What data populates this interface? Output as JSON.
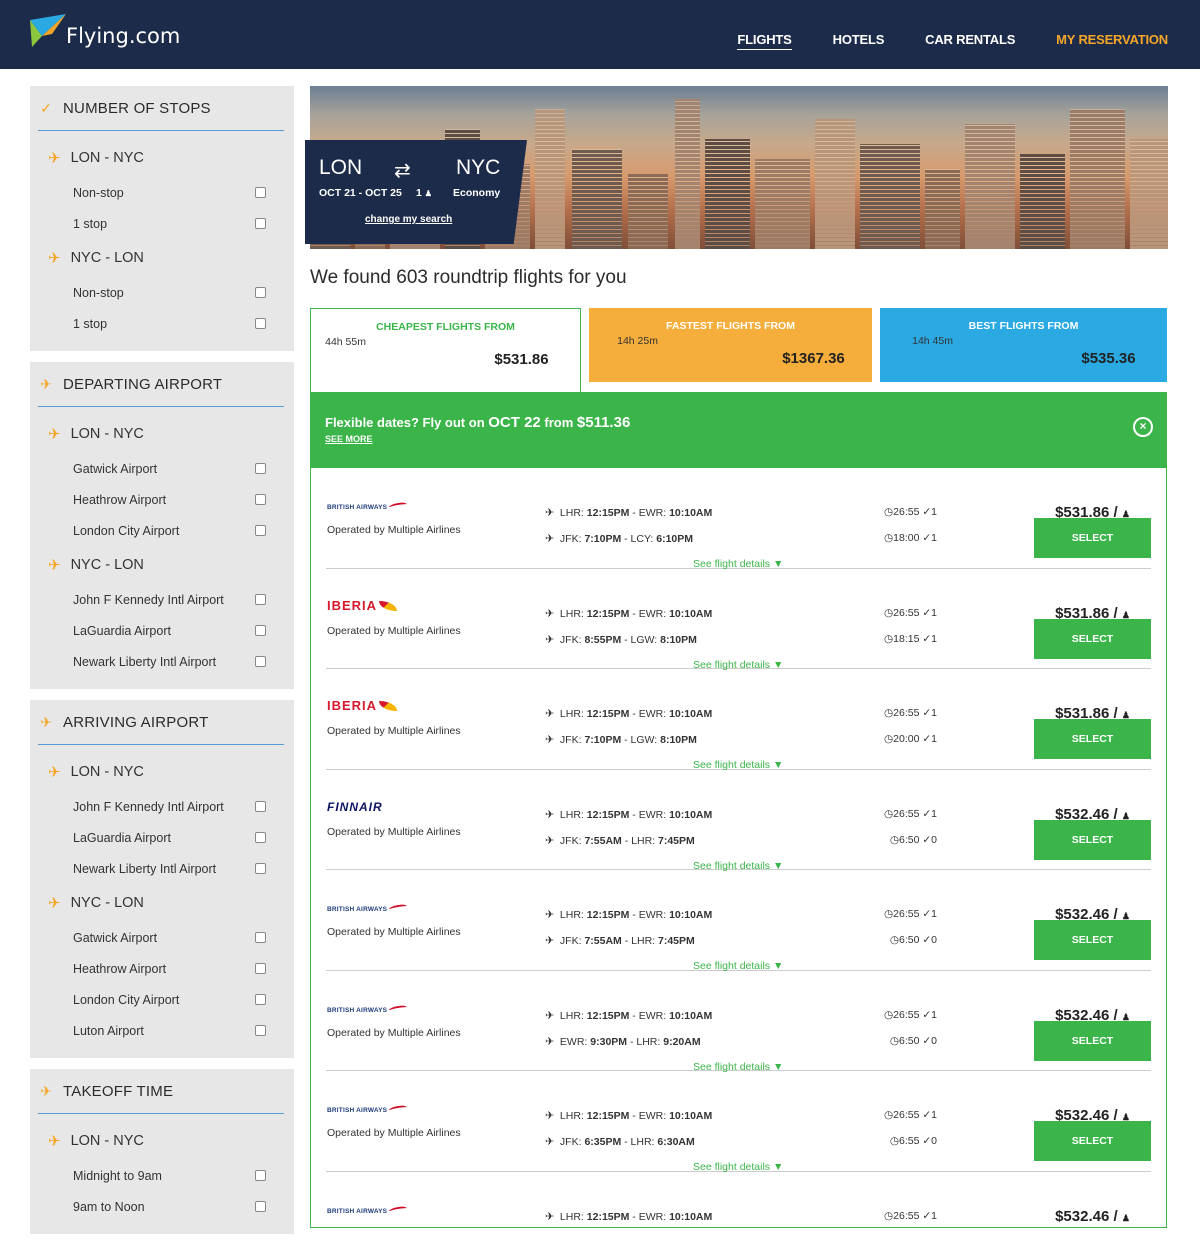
{
  "header": {
    "logo_text": "Flying.com",
    "nav": [
      "FLIGHTS",
      "HOTELS",
      "CAR RENTALS",
      "MY RESERVATION"
    ]
  },
  "sidebar": {
    "panels": [
      {
        "title": "NUMBER OF STOPS",
        "groups": [
          {
            "route": "LON - NYC",
            "options": [
              "Non-stop",
              "1 stop"
            ]
          },
          {
            "route": "NYC - LON",
            "options": [
              "Non-stop",
              "1 stop"
            ]
          }
        ]
      },
      {
        "title": "DEPARTING AIRPORT",
        "groups": [
          {
            "route": "LON - NYC",
            "options": [
              "Gatwick Airport",
              "Heathrow Airport",
              "London City Airport"
            ]
          },
          {
            "route": "NYC - LON",
            "options": [
              "John F Kennedy Intl Airport",
              "LaGuardia Airport",
              "Newark Liberty Intl Airport"
            ]
          }
        ]
      },
      {
        "title": "ARRIVING AIRPORT",
        "groups": [
          {
            "route": "LON - NYC",
            "options": [
              "John F Kennedy Intl Airport",
              "LaGuardia Airport",
              "Newark Liberty Intl Airport"
            ]
          },
          {
            "route": "NYC - LON",
            "options": [
              "Gatwick Airport",
              "Heathrow Airport",
              "London City Airport",
              "Luton Airport"
            ]
          }
        ]
      },
      {
        "title": "TAKEOFF TIME",
        "groups": [
          {
            "route": "LON - NYC",
            "options": [
              "Midnight to 9am",
              "9am to Noon"
            ]
          }
        ]
      }
    ]
  },
  "search": {
    "from": "LON",
    "to": "NYC",
    "dates": "OCT 21 - OCT 25",
    "passengers": "1",
    "cabin": "Economy",
    "change_label": "change my search"
  },
  "found_text": "We found 603 roundtrip flights for you",
  "summary_tabs": [
    {
      "label": "CHEAPEST FLIGHTS FROM",
      "price": "$531.86",
      "duration": "44h 55m"
    },
    {
      "label": "FASTEST FLIGHTS FROM",
      "price": "$1367.36",
      "duration": "14h 25m"
    },
    {
      "label": "BEST FLIGHTS FROM",
      "price": "$535.36",
      "duration": "14h 45m"
    }
  ],
  "flex_banner": {
    "prefix": "Flexible dates? Fly out on ",
    "date": "OCT 22",
    "middle": " from ",
    "price": "$511.36",
    "see_more": "SEE MORE"
  },
  "results": [
    {
      "airline": "BRITISH AIRWAYS",
      "logo": "ba",
      "operated": "Operated by Multiple Airlines",
      "leg1": {
        "from": "LHR:",
        "dep": "12:15PM",
        "to": "EWR:",
        "arr": "10:10AM",
        "duration": "26:55",
        "stops": "1"
      },
      "leg2": {
        "from": "JFK:",
        "dep": "7:10PM",
        "to": "LCY:",
        "arr": "6:10PM",
        "duration": "18:00",
        "stops": "1"
      },
      "details": "See flight details",
      "price": "$531.86 /",
      "select": "SELECT"
    },
    {
      "airline": "IBERIA",
      "logo": "iberia",
      "operated": "Operated by Multiple Airlines",
      "leg1": {
        "from": "LHR:",
        "dep": "12:15PM",
        "to": "EWR:",
        "arr": "10:10AM",
        "duration": "26:55",
        "stops": "1"
      },
      "leg2": {
        "from": "JFK:",
        "dep": "8:55PM",
        "to": "LGW:",
        "arr": "8:10PM",
        "duration": "18:15",
        "stops": "1"
      },
      "details": "See flight details",
      "price": "$531.86 /",
      "select": "SELECT"
    },
    {
      "airline": "IBERIA",
      "logo": "iberia",
      "operated": "Operated by Multiple Airlines",
      "leg1": {
        "from": "LHR:",
        "dep": "12:15PM",
        "to": "EWR:",
        "arr": "10:10AM",
        "duration": "26:55",
        "stops": "1"
      },
      "leg2": {
        "from": "JFK:",
        "dep": "7:10PM",
        "to": "LGW:",
        "arr": "8:10PM",
        "duration": "20:00",
        "stops": "1"
      },
      "details": "See flight details",
      "price": "$531.86 /",
      "select": "SELECT"
    },
    {
      "airline": "FINNAIR",
      "logo": "finnair",
      "operated": "Operated by Multiple Airlines",
      "leg1": {
        "from": "LHR:",
        "dep": "12:15PM",
        "to": "EWR:",
        "arr": "10:10AM",
        "duration": "26:55",
        "stops": "1"
      },
      "leg2": {
        "from": "JFK:",
        "dep": "7:55AM",
        "to": "LHR:",
        "arr": "7:45PM",
        "duration": "6:50",
        "stops": "0"
      },
      "details": "See flight details",
      "price": "$532.46 /",
      "select": "SELECT"
    },
    {
      "airline": "BRITISH AIRWAYS",
      "logo": "ba",
      "operated": "Operated by Multiple Airlines",
      "leg1": {
        "from": "LHR:",
        "dep": "12:15PM",
        "to": "EWR:",
        "arr": "10:10AM",
        "duration": "26:55",
        "stops": "1"
      },
      "leg2": {
        "from": "JFK:",
        "dep": "7:55AM",
        "to": "LHR:",
        "arr": "7:45PM",
        "duration": "6:50",
        "stops": "0"
      },
      "details": "See flight details",
      "price": "$532.46 /",
      "select": "SELECT"
    },
    {
      "airline": "BRITISH AIRWAYS",
      "logo": "ba",
      "operated": "Operated by Multiple Airlines",
      "leg1": {
        "from": "LHR:",
        "dep": "12:15PM",
        "to": "EWR:",
        "arr": "10:10AM",
        "duration": "26:55",
        "stops": "1"
      },
      "leg2": {
        "from": "EWR:",
        "dep": "9:30PM",
        "to": "LHR:",
        "arr": "9:20AM",
        "duration": "6:50",
        "stops": "0"
      },
      "details": "See flight details",
      "price": "$532.46 /",
      "select": "SELECT"
    },
    {
      "airline": "BRITISH AIRWAYS",
      "logo": "ba",
      "operated": "Operated by Multiple Airlines",
      "leg1": {
        "from": "LHR:",
        "dep": "12:15PM",
        "to": "EWR:",
        "arr": "10:10AM",
        "duration": "26:55",
        "stops": "1"
      },
      "leg2": {
        "from": "JFK:",
        "dep": "6:35PM",
        "to": "LHR:",
        "arr": "6:30AM",
        "duration": "6:55",
        "stops": "0"
      },
      "details": "See flight details",
      "price": "$532.46 /",
      "select": "SELECT"
    },
    {
      "airline": "BRITISH AIRWAYS",
      "logo": "ba",
      "operated": "",
      "leg1": {
        "from": "LHR:",
        "dep": "12:15PM",
        "to": "EWR:",
        "arr": "10:10AM",
        "duration": "26:55",
        "stops": "1"
      },
      "leg2": null,
      "details": "",
      "price": "$532.46 /",
      "select": ""
    }
  ],
  "colors": {
    "navy": "#1d2b4a",
    "orange": "#f4a628",
    "green": "#3bb54a",
    "blue": "#2aa9e2"
  },
  "icons": {
    "plane": "plane-icon",
    "clock": "clock-icon",
    "stops": "stops-icon",
    "person": "person-icon",
    "swap": "swap-icon",
    "close": "close-icon"
  }
}
